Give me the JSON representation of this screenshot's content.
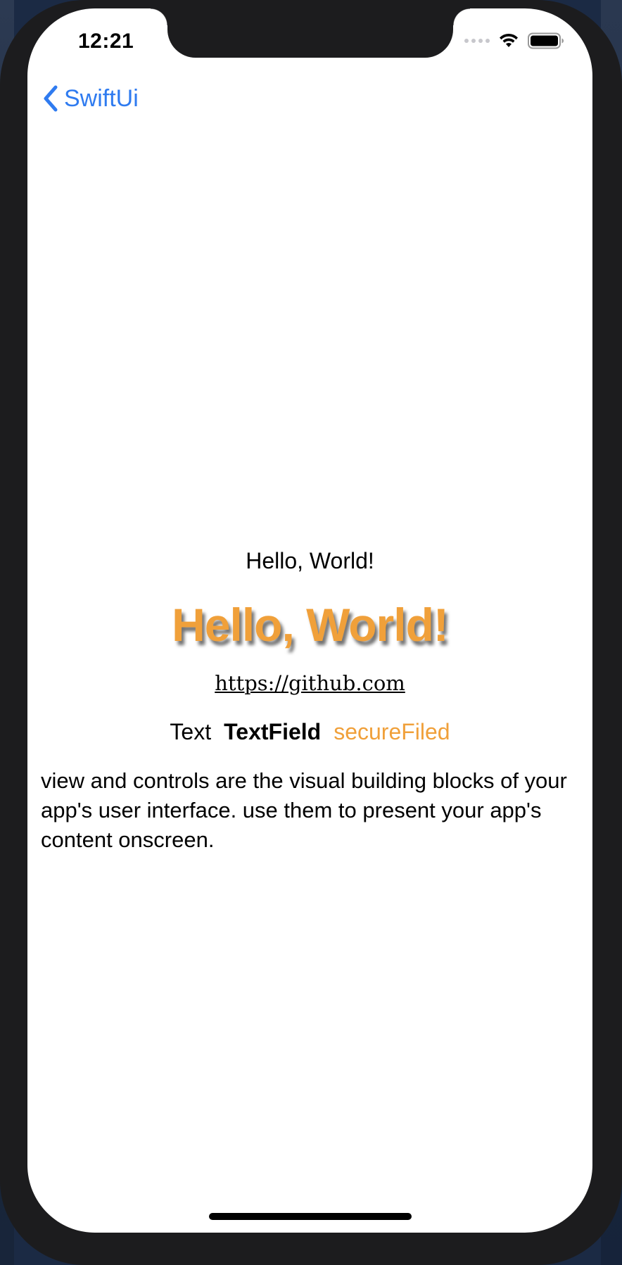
{
  "status_bar": {
    "time": "12:21"
  },
  "nav": {
    "back_label": "SwiftUi"
  },
  "content": {
    "hello_plain": "Hello, World!",
    "hello_styled": "Hello, World!",
    "link_text": "https://github.com",
    "row_text": "Text",
    "row_textfield": "TextField",
    "row_securefield": "secureFiled",
    "paragraph": "view and controls are the visual building blocks of your app's user interface. use them to present your app's content onscreen."
  },
  "colors": {
    "accent_blue": "#2f7bf0",
    "orange": "#f0a03a"
  },
  "icons": {
    "back": "chevron-left-icon",
    "signal": "cellular-signal-icon",
    "wifi": "wifi-icon",
    "battery": "battery-icon"
  }
}
